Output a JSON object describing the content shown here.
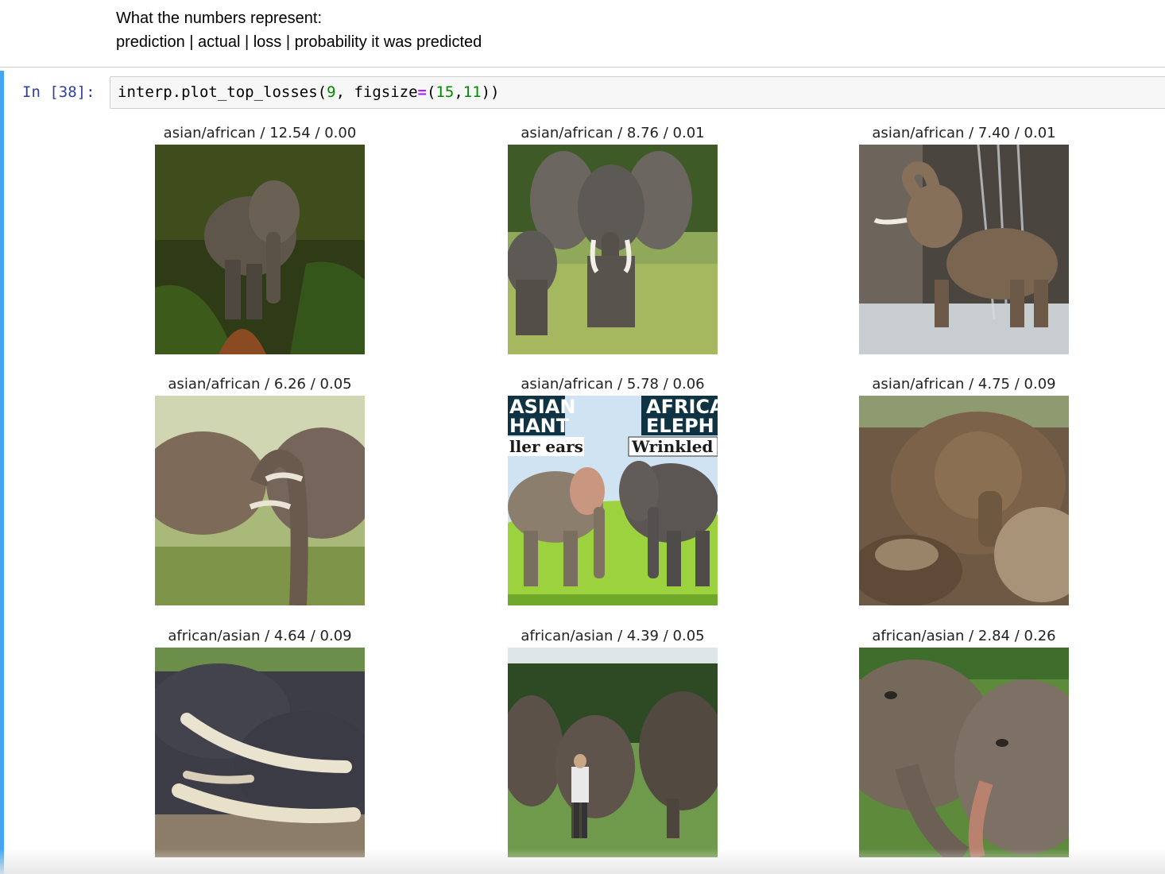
{
  "markdown": {
    "line1": "What the numbers represent:",
    "line2": "prediction | actual | loss | probability it was predicted"
  },
  "cell": {
    "prompt": "In [38]:",
    "code": {
      "fn": "interp.plot_top_losses(",
      "arg1": "9",
      "sep": ", figsize",
      "eq": "=",
      "open": "(",
      "w": "15",
      "comma": ",",
      "h": "11",
      "close": "))"
    }
  },
  "plots": [
    {
      "title": "asian/african / 12.54 / 0.00",
      "image": "elephant on forest path"
    },
    {
      "title": "asian/african / 8.76 / 0.01",
      "image": "african elephant with calf in grass"
    },
    {
      "title": "asian/african / 7.40 / 0.01",
      "image": "elephant spraying water"
    },
    {
      "title": "asian/african / 6.26 / 0.05",
      "image": "two elephants trunks entwined"
    },
    {
      "title": "asian/african / 5.78 / 0.06",
      "image": "asian vs african elephant illustration",
      "overlay": {
        "left_top": "ASIAN",
        "left_mid": "HANT",
        "left_sub": "ller ears",
        "right_top": "AFRICA",
        "right_mid": "ELEPH",
        "right_sub": "Wrinkled"
      }
    },
    {
      "title": "asian/african / 4.75 / 0.09",
      "image": "baby elephant in mud"
    },
    {
      "title": "african/asian / 4.64 / 0.09",
      "image": "elephants with crossed tusks"
    },
    {
      "title": "african/asian / 4.39 / 0.05",
      "image": "elephants standing with trainer"
    },
    {
      "title": "african/asian / 2.84 / 0.26",
      "image": "two elephant faces close-up"
    }
  ],
  "colors": {
    "prompt": "#303f9f",
    "selected_bar": "#42a5f5",
    "number": "#008800",
    "operator": "#aa22ff"
  }
}
